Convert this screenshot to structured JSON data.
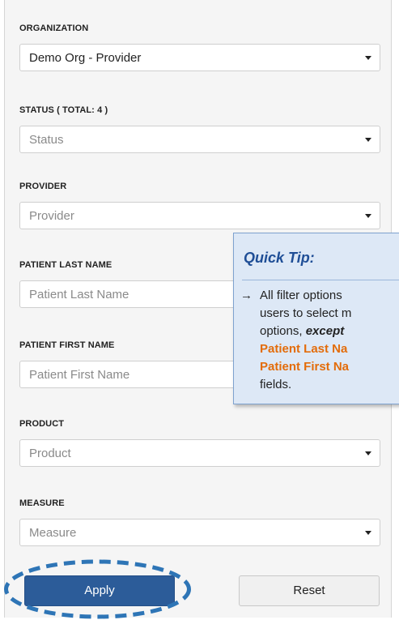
{
  "filters": {
    "organization": {
      "label": "ORGANIZATION",
      "value": "Demo Org - Provider"
    },
    "status": {
      "label": "STATUS ( TOTAL: 4 )",
      "placeholder": "Status"
    },
    "provider": {
      "label": "PROVIDER",
      "placeholder": "Provider"
    },
    "patient_last_name": {
      "label": "PATIENT LAST NAME",
      "placeholder": "Patient Last Name"
    },
    "patient_first_name": {
      "label": "PATIENT FIRST NAME",
      "placeholder": "Patient First Name"
    },
    "product": {
      "label": "PRODUCT",
      "placeholder": "Product"
    },
    "measure": {
      "label": "MEASURE",
      "placeholder": "Measure"
    }
  },
  "buttons": {
    "apply": "Apply",
    "reset": "Reset"
  },
  "tip": {
    "title": "Quick Tip:",
    "arrow": "→",
    "line1": "All filter options",
    "line2": "users to select m",
    "line3a": "options, ",
    "line3b": "except",
    "line4": "Patient Last Na",
    "line5": "Patient First Na",
    "line6": "fields."
  },
  "colors": {
    "apply_bg": "#2c5c99",
    "tip_bg": "#dde8f6",
    "tip_title": "#1f4e96",
    "tip_highlight": "#e36c0a",
    "ring": "#2e75b6"
  }
}
